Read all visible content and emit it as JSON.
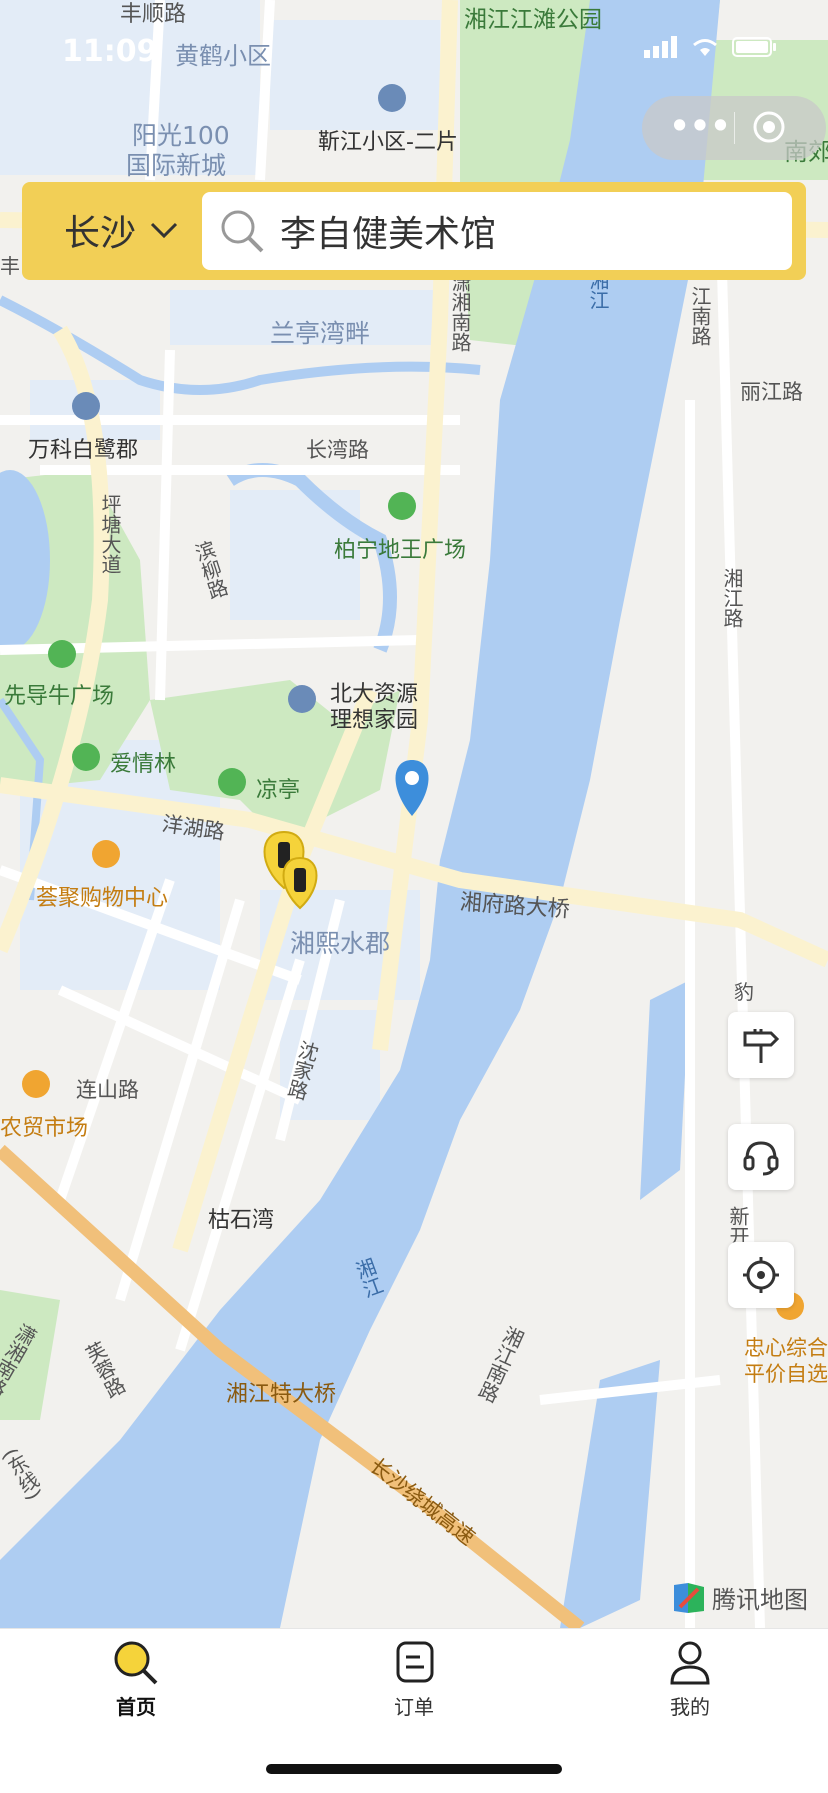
{
  "status_bar": {
    "time": "11:09"
  },
  "top_bar": {
    "city": "长沙",
    "search_text": "李自健美术馆"
  },
  "map": {
    "labels": [
      {
        "text": "丰顺路",
        "class": "road"
      },
      {
        "text": "黄鹤小区",
        "class": "area"
      },
      {
        "text": "湘江江滩公园",
        "class": "green"
      },
      {
        "text": "阳光100",
        "class": "area"
      },
      {
        "text": "国际新城",
        "class": "area"
      },
      {
        "text": "靳江小区-二片",
        "class": "poi"
      },
      {
        "text": "南郊",
        "class": "green"
      },
      {
        "text": "兰亭湾畔",
        "class": "area"
      },
      {
        "text": "潇湘南路",
        "class": "road"
      },
      {
        "text": "江南路",
        "class": "road"
      },
      {
        "text": "丽江路",
        "class": "road"
      },
      {
        "text": "万科白鹭郡",
        "class": "poi"
      },
      {
        "text": "长湾路",
        "class": "road"
      },
      {
        "text": "坪塘大道",
        "class": "road"
      },
      {
        "text": "柏宁地王广场",
        "class": "green"
      },
      {
        "text": "滨柳路",
        "class": "road"
      },
      {
        "text": "湘江路",
        "class": "road"
      },
      {
        "text": "先导牛广场",
        "class": "green"
      },
      {
        "text": "北大资源",
        "class": "poi"
      },
      {
        "text": "理想家园",
        "class": "poi"
      },
      {
        "text": "爱情林",
        "class": "green"
      },
      {
        "text": "凉亭",
        "class": "green"
      },
      {
        "text": "洋湖路",
        "class": "road"
      },
      {
        "text": "荟聚购物中心",
        "class": "shop"
      },
      {
        "text": "湘府路大桥",
        "class": "road"
      },
      {
        "text": "湘熙水郡",
        "class": "area"
      },
      {
        "text": "沈家路",
        "class": "road"
      },
      {
        "text": "连山路",
        "class": "road"
      },
      {
        "text": "农贸市场",
        "class": "shop"
      },
      {
        "text": "枯石湾",
        "class": "poi"
      },
      {
        "text": "湘江",
        "class": "water"
      },
      {
        "text": "忠心综合",
        "class": "shop"
      },
      {
        "text": "平价自选",
        "class": "shop"
      },
      {
        "text": "潇湘南路",
        "class": "road"
      },
      {
        "text": "湘江特大桥",
        "class": "highway"
      },
      {
        "text": "长沙绕城高速",
        "class": "highway"
      },
      {
        "text": "湘江南路",
        "class": "road"
      },
      {
        "text": "湘江",
        "class": "water"
      },
      {
        "text": "新开",
        "class": "road"
      },
      {
        "text": "豹",
        "class": "road"
      },
      {
        "text": "芙蓉路",
        "class": "road"
      },
      {
        "text": "(东线)",
        "class": "road"
      },
      {
        "text": "丰",
        "class": "road"
      }
    ],
    "attribution": "腾讯地图"
  },
  "tabs": [
    {
      "label": "首页",
      "active": true
    },
    {
      "label": "订单",
      "active": false
    },
    {
      "label": "我的",
      "active": false
    }
  ],
  "colors": {
    "brand_yellow": "#f2cf56",
    "water": "#aecdf2",
    "green": "#cde9c1",
    "land": "#f2f1ee",
    "highway": "#f1c07a",
    "pin_blue": "#3d8edb"
  }
}
